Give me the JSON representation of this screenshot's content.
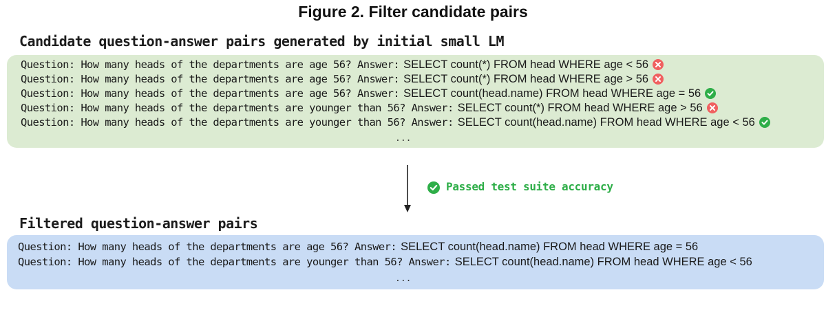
{
  "figure_title": "Figure 2. Filter candidate pairs",
  "candidates": {
    "heading": "Candidate question-answer pairs generated by initial small LM",
    "pairs": [
      {
        "question": "Question: How many heads of the departments are age 56? Answer:",
        "answer": "SELECT count(*) FROM head WHERE age < 56",
        "status": "fail"
      },
      {
        "question": "Question: How many heads of the departments are age 56? Answer:",
        "answer": "SELECT count(*) FROM head WHERE age > 56",
        "status": "fail"
      },
      {
        "question": "Question: How many heads of the departments are age 56? Answer:",
        "answer": "SELECT count(head.name) FROM head WHERE age = 56",
        "status": "pass"
      },
      {
        "question": "Question: How many heads of the departments are younger than 56? Answer:",
        "answer": "SELECT count(*) FROM head WHERE age > 56",
        "status": "fail"
      },
      {
        "question": "Question: How many heads of the departments are younger than 56? Answer:",
        "answer": "SELECT count(head.name) FROM head WHERE age < 56",
        "status": "pass"
      }
    ],
    "ellipsis": "..."
  },
  "filter_step": {
    "label": "Passed test suite accuracy",
    "icon": "check-circle-icon"
  },
  "filtered": {
    "heading": "Filtered question-answer pairs",
    "pairs": [
      {
        "question": "Question: How many heads of the departments are age 56? Answer:",
        "answer": "SELECT count(head.name) FROM head WHERE age = 56"
      },
      {
        "question": "Question: How many heads of the departments are younger than 56? Answer:",
        "answer": "SELECT count(head.name) FROM head WHERE age < 56"
      }
    ],
    "ellipsis": "..."
  },
  "colors": {
    "candidate_panel": "#dcebd2",
    "filtered_panel": "#c9dcf5",
    "pass": "#2eae48",
    "fail": "#f06060"
  }
}
